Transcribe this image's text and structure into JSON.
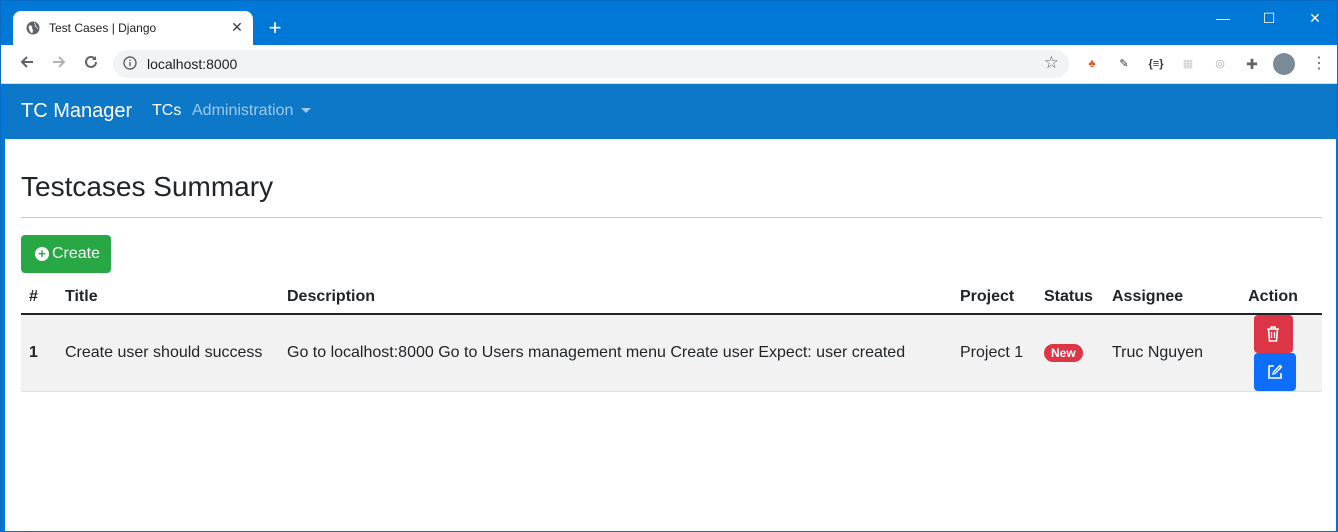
{
  "browser": {
    "tab_title": "Test Cases | Django",
    "tab_close": "✕",
    "new_tab": "+",
    "url": "localhost:8000",
    "minimize": "—",
    "maximize": "☐",
    "close": "✕"
  },
  "navbar": {
    "brand": "TC Manager",
    "items": [
      {
        "label": "TCs"
      },
      {
        "label": "Administration"
      }
    ]
  },
  "main": {
    "title": "Testcases Summary",
    "create_label": "Create"
  },
  "table": {
    "headers": [
      "#",
      "Title",
      "Description",
      "Project",
      "Status",
      "Assignee",
      "Action"
    ],
    "rows": [
      {
        "num": "1",
        "title": "Create user should success",
        "description": "Go to localhost:8000 Go to Users management menu Create user Expect: user created",
        "project": "Project 1",
        "status": "New",
        "assignee": "Truc Nguyen"
      }
    ]
  },
  "colors": {
    "chrome_blue": "#0078d7",
    "navbar": "#0d78c7",
    "success": "#28a745",
    "danger": "#dc3545",
    "primary": "#0d6efd"
  }
}
